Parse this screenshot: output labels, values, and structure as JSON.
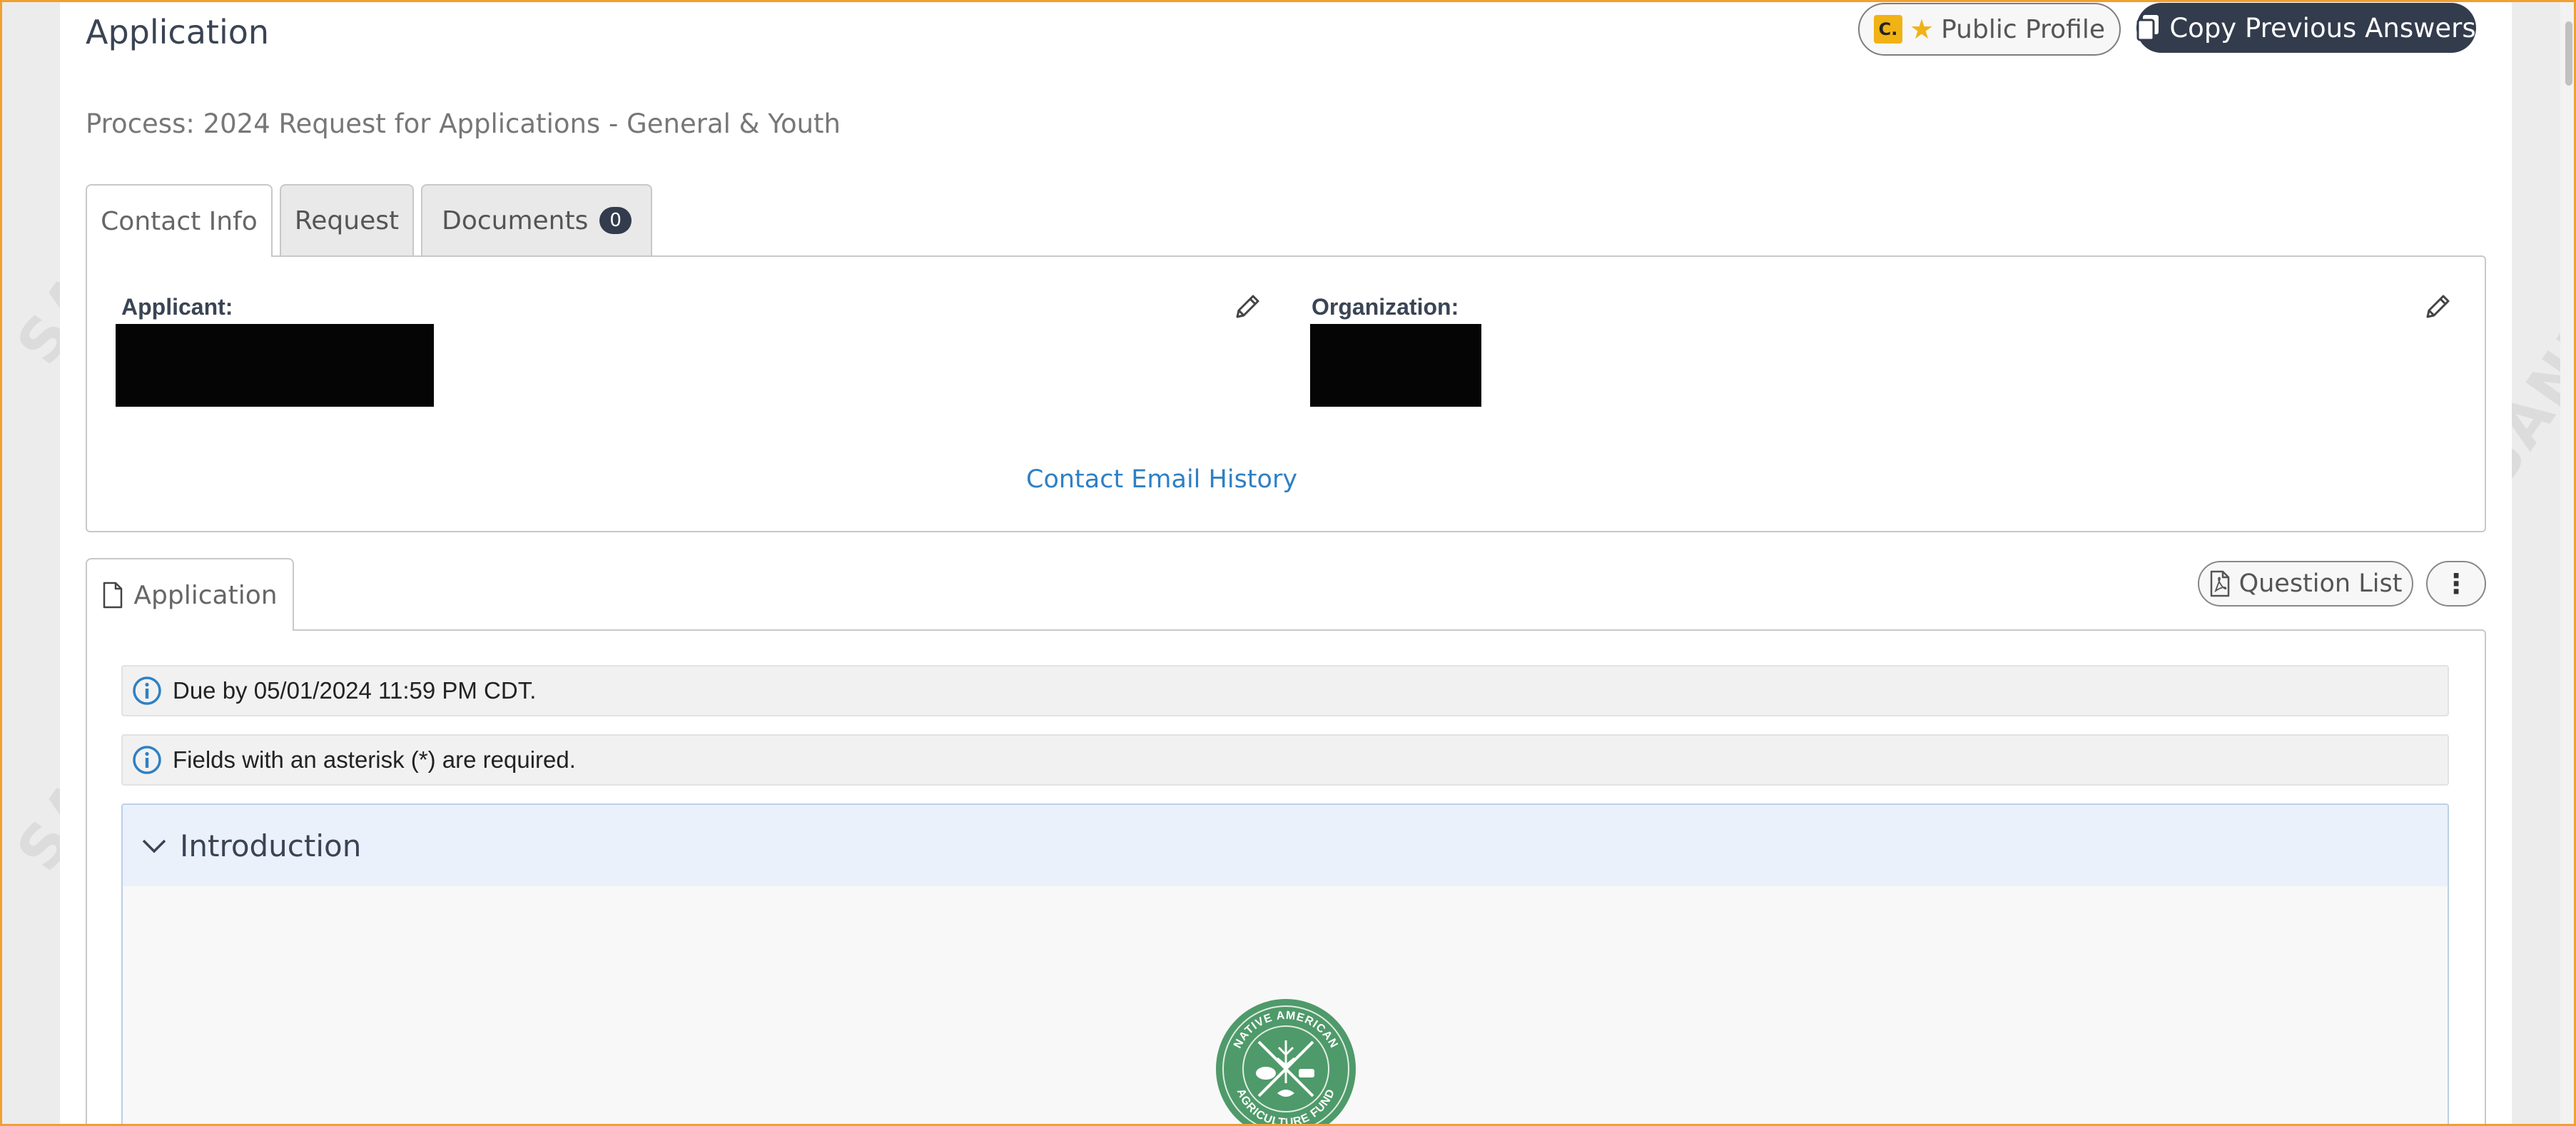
{
  "page": {
    "title": "Application",
    "process": "Process: 2024 Request for Applications - General & Youth",
    "watermark_text": "SANDBOX"
  },
  "header_buttons": {
    "public_profile": {
      "badge": "C.",
      "label": "Public Profile"
    },
    "copy_previous": {
      "label": "Copy Previous Answers"
    }
  },
  "tabs": [
    {
      "label": "Contact Info",
      "active": true
    },
    {
      "label": "Request",
      "active": false
    },
    {
      "label": "Documents",
      "active": false,
      "count": "0"
    }
  ],
  "contact": {
    "applicant_label": "Applicant:",
    "organization_label": "Organization:",
    "email_history_link": "Contact Email History"
  },
  "application_tab": {
    "label": "Application"
  },
  "toolbar": {
    "question_list_label": "Question List",
    "more_icon": "vertical-ellipsis"
  },
  "notices": [
    {
      "icon": "info-icon",
      "text": "Due by 05/01/2024 11:59 PM CDT."
    },
    {
      "icon": "info-icon",
      "text": "Fields with an asterisk (*) are required."
    }
  ],
  "section": {
    "title": "Introduction",
    "expanded": true,
    "logo_text_top": "NATIVE AMERICAN",
    "logo_text_bottom": "AGRICULTURE FUND"
  },
  "colors": {
    "accent_dark": "#333c4c",
    "link": "#2f80c4",
    "info_blue": "#2f80c4",
    "badge_yellow": "#f1b215",
    "frame_orange": "#f0a030",
    "logo_green": "#4f9a6a"
  }
}
